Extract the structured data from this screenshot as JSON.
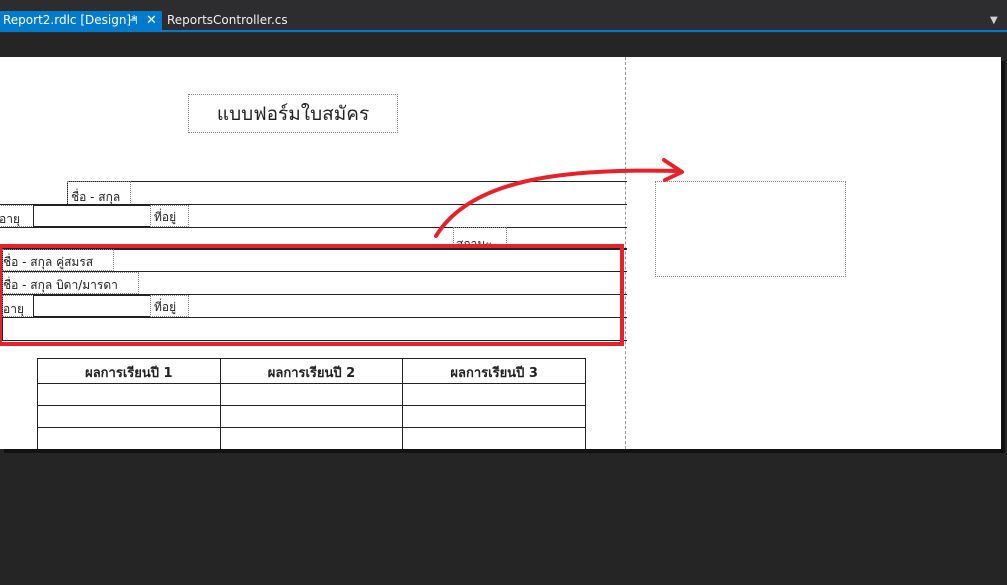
{
  "tabs": {
    "active": {
      "label": "Report2.rdlc [Design]*",
      "pin_icon": "pin-icon",
      "close_icon": "close-icon"
    },
    "inactive": {
      "label": "ReportsController.cs"
    },
    "dropdown_icon": "chevron-down-icon"
  },
  "report": {
    "title": "แบบฟอร์มใบสมัคร",
    "labels": {
      "name_top": "ชื่อ - สกุล",
      "age_1": "อายุ",
      "address_1": "ที่อยู่",
      "status": "สถานะ",
      "name_spouse": "ชื่อ - สกุล คู่สมรส",
      "name_parent": "ชื่อ - สกุล บิดา/มารดา",
      "age_2": "อายุ",
      "address_2": "ที่อยู่"
    },
    "grades_headers": [
      "ผลการเรียนปี 1",
      "ผลการเรียนปี 2",
      "ผลการเรียนปี 3"
    ]
  },
  "colors": {
    "accent": "#007acc",
    "highlight": "#e8202a",
    "background": "#252526"
  }
}
